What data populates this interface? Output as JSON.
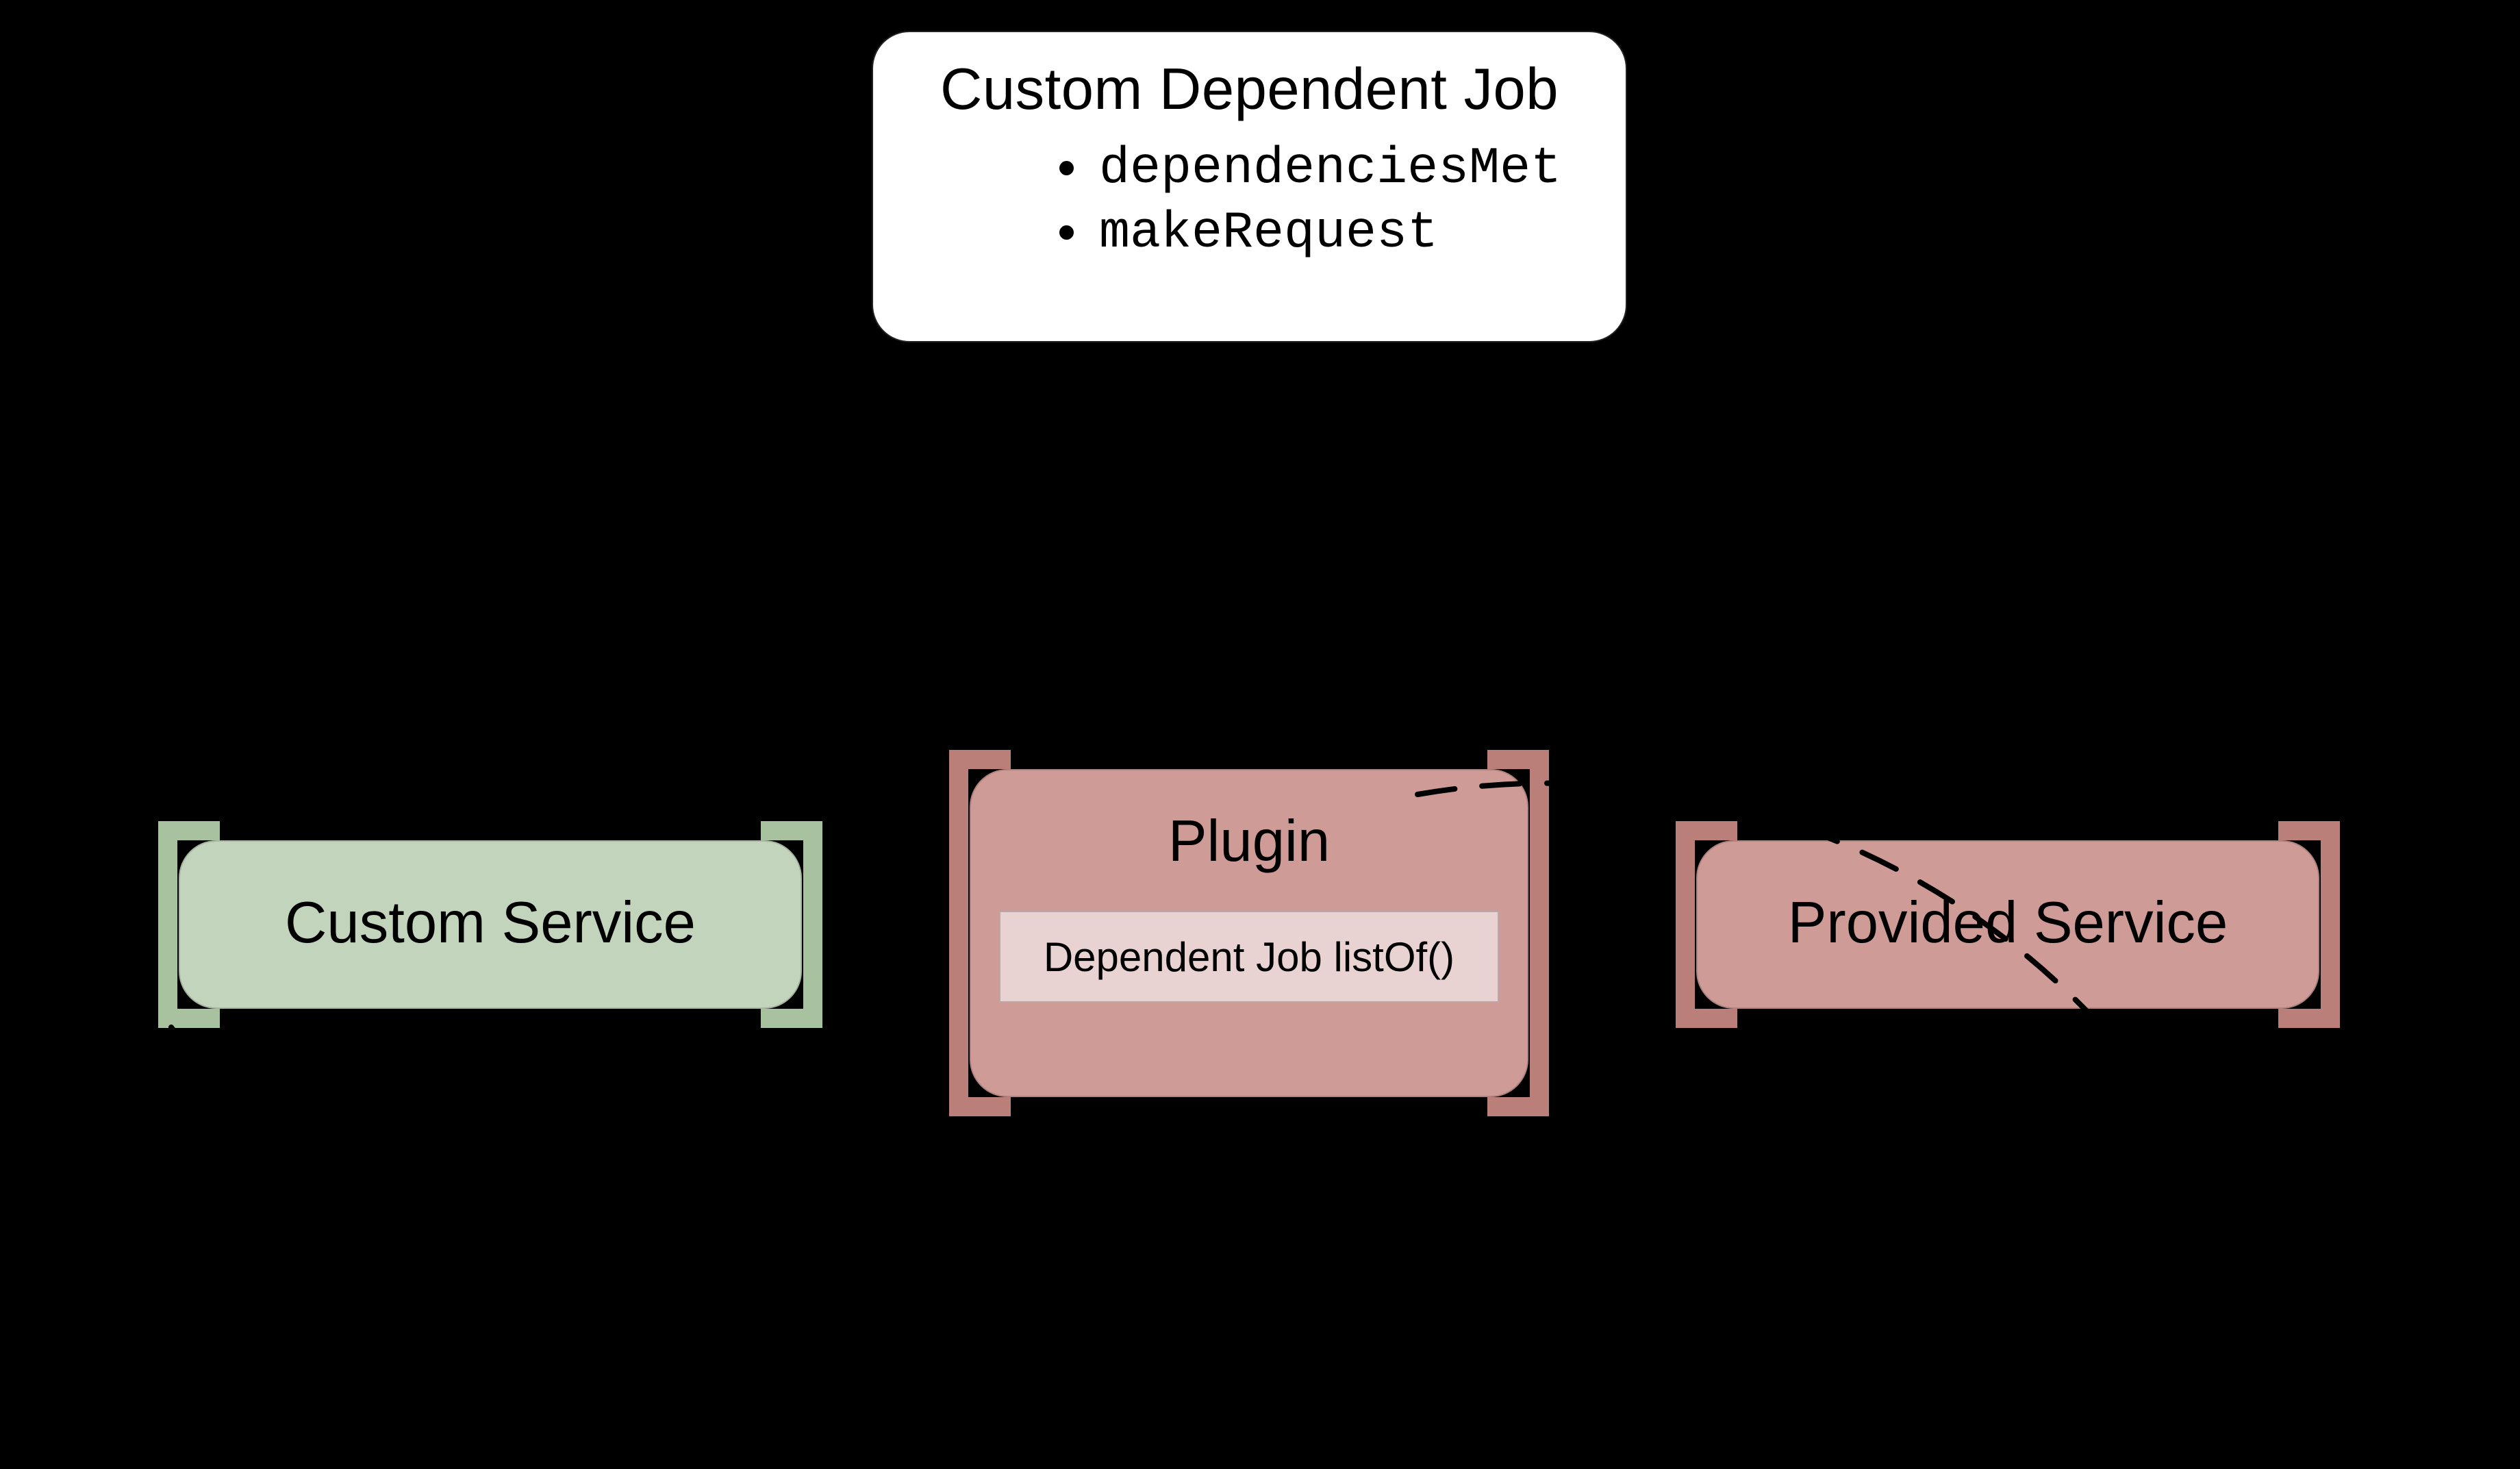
{
  "top_card": {
    "title": "Custom Dependent Job",
    "items": [
      "dependenciesMet",
      "makeRequest"
    ]
  },
  "services": {
    "custom": {
      "label": "Custom Service"
    },
    "plugin": {
      "label": "Plugin",
      "sub_label": "Dependent Job listOf()"
    },
    "provided": {
      "label": "Provided Service"
    }
  },
  "colors": {
    "green_fill": "#c3d4bd",
    "green_stroke": "#a8c19e",
    "pink_fill": "#cf9b96",
    "pink_stroke": "#bb7f7a",
    "inner_pink": "#e9d3d2"
  }
}
